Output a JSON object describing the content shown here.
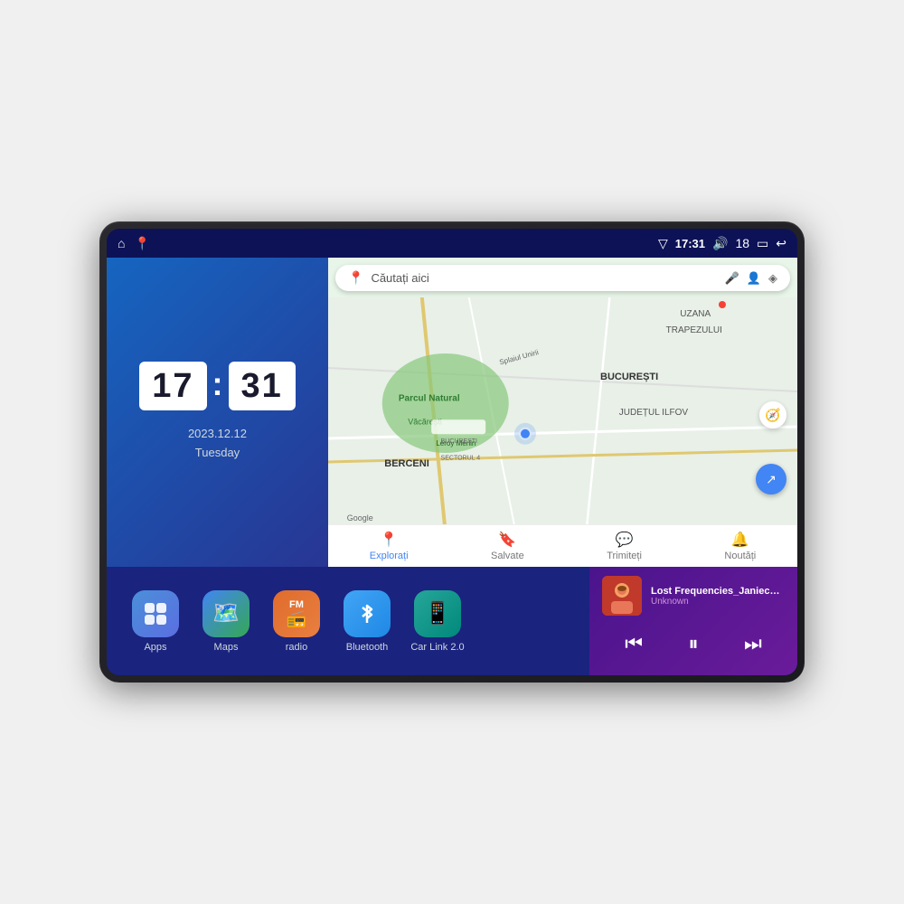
{
  "device": {
    "status_bar": {
      "left_icons": [
        "home",
        "maps"
      ],
      "time": "17:31",
      "signal_icon": "▽",
      "volume_icon": "🔊",
      "battery_level": "18",
      "battery_icon": "▭",
      "back_icon": "↩"
    },
    "clock": {
      "hour": "17",
      "minute": "31",
      "date": "2023.12.12",
      "day": "Tuesday"
    },
    "map": {
      "search_placeholder": "Căutați aici",
      "location_label": "Parcul Natural Văcărești",
      "area_labels": [
        "BUCUREȘTI",
        "JUDEȚUL ILFOV",
        "BERCENI",
        "TRAPEZULUI",
        "UZANA"
      ],
      "nav_items": [
        {
          "label": "Explorați",
          "icon": "📍",
          "active": true
        },
        {
          "label": "Salvate",
          "icon": "🔖",
          "active": false
        },
        {
          "label": "Trimiteți",
          "icon": "💬",
          "active": false
        },
        {
          "label": "Noutăți",
          "icon": "🔔",
          "active": false
        }
      ],
      "google_label": "Google"
    },
    "apps": [
      {
        "id": "apps",
        "label": "Apps",
        "icon": "⊞",
        "color_class": "apps-icon"
      },
      {
        "id": "maps",
        "label": "Maps",
        "icon": "📍",
        "color_class": "maps-icon"
      },
      {
        "id": "radio",
        "label": "radio",
        "icon": "📻",
        "color_class": "radio-icon"
      },
      {
        "id": "bluetooth",
        "label": "Bluetooth",
        "icon": "🔷",
        "color_class": "bluetooth-icon"
      },
      {
        "id": "carlink",
        "label": "Car Link 2.0",
        "icon": "📱",
        "color_class": "carlink-icon"
      }
    ],
    "music": {
      "title": "Lost Frequencies_Janieck Devy-...",
      "artist": "Unknown",
      "controls": {
        "prev": "⏮",
        "play_pause": "⏸",
        "next": "⏭"
      }
    }
  }
}
